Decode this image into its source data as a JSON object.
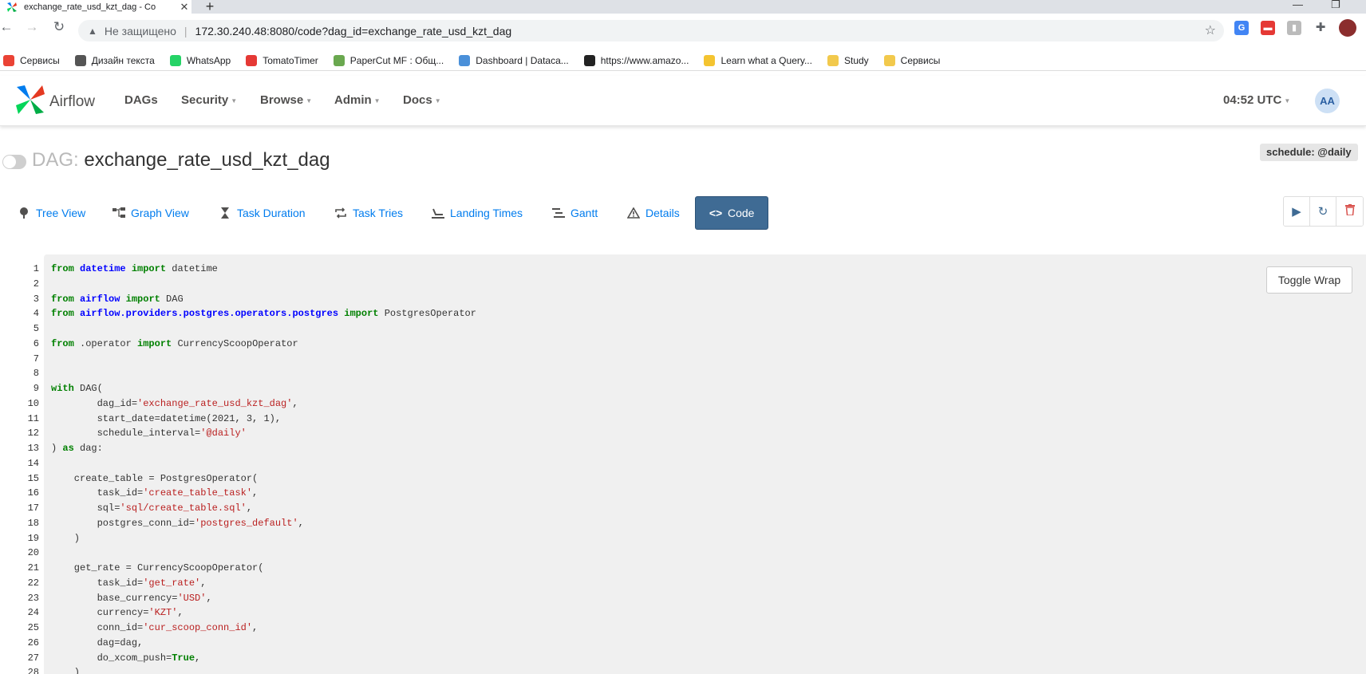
{
  "browser": {
    "tab_title": "exchange_rate_usd_kzt_dag - Co",
    "insecure_label": "Не защищено",
    "url": "172.30.240.48:8080/code?dag_id=exchange_rate_usd_kzt_dag",
    "bookmarks": [
      {
        "label": "Сервисы",
        "color": "#ea4335"
      },
      {
        "label": "Дизайн текста",
        "color": "#555555"
      },
      {
        "label": "WhatsApp",
        "color": "#25d366"
      },
      {
        "label": "TomatoTimer",
        "color": "#e53935"
      },
      {
        "label": "PaperCut MF : Общ...",
        "color": "#6aa84f"
      },
      {
        "label": "Dashboard | Dataca...",
        "color": "#4a90d9"
      },
      {
        "label": "https://www.amazo...",
        "color": "#222222"
      },
      {
        "label": "Learn what a Query...",
        "color": "#f4c430"
      },
      {
        "label": "Study",
        "color": "#f2c94c"
      },
      {
        "label": "Сервисы",
        "color": "#f2c94c"
      }
    ]
  },
  "airflow": {
    "brand": "Airflow",
    "nav": [
      "DAGs",
      "Security",
      "Browse",
      "Admin",
      "Docs"
    ],
    "clock": "04:52 UTC",
    "avatar": "AA"
  },
  "dag": {
    "label": "DAG:",
    "id": "exchange_rate_usd_kzt_dag",
    "schedule": "schedule: @daily"
  },
  "view_tabs": [
    {
      "label": "Tree View",
      "icon": "tree-icon"
    },
    {
      "label": "Graph View",
      "icon": "graph-icon"
    },
    {
      "label": "Task Duration",
      "icon": "hourglass-icon"
    },
    {
      "label": "Task Tries",
      "icon": "retry-icon"
    },
    {
      "label": "Landing Times",
      "icon": "landing-icon"
    },
    {
      "label": "Gantt",
      "icon": "gantt-icon"
    },
    {
      "label": "Details",
      "icon": "warning-icon"
    },
    {
      "label": "Code",
      "icon": "code-icon"
    }
  ],
  "toggle_wrap_label": "Toggle Wrap",
  "code_lines": [
    "from datetime import datetime",
    "",
    "from airflow import DAG",
    "from airflow.providers.postgres.operators.postgres import PostgresOperator",
    "",
    "from .operator import CurrencyScoopOperator",
    "",
    "",
    "with DAG(",
    "        dag_id='exchange_rate_usd_kzt_dag',",
    "        start_date=datetime(2021, 3, 1),",
    "        schedule_interval='@daily'",
    ") as dag:",
    "",
    "    create_table = PostgresOperator(",
    "        task_id='create_table_task',",
    "        sql='sql/create_table.sql',",
    "        postgres_conn_id='postgres_default',",
    "    )",
    "",
    "    get_rate = CurrencyScoopOperator(",
    "        task_id='get_rate',",
    "        base_currency='USD',",
    "        currency='KZT',",
    "        conn_id='cur_scoop_conn_id',",
    "        dag=dag,",
    "        do_xcom_push=True,",
    "    )"
  ]
}
